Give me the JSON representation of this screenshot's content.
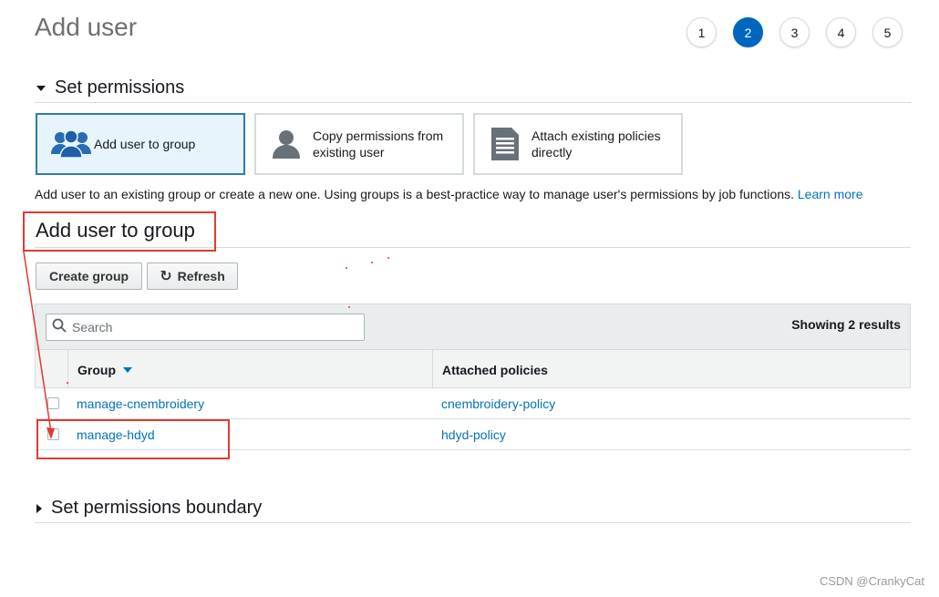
{
  "header": {
    "title": "Add user",
    "steps": [
      "1",
      "2",
      "3",
      "4",
      "5"
    ],
    "active_step": "2"
  },
  "permissions": {
    "section_title": "Set permissions",
    "options": [
      {
        "label": "Add user to group",
        "icon": "group-icon",
        "selected": true
      },
      {
        "label_line1": "Copy permissions from",
        "label_line2": "existing user",
        "icon": "user-icon",
        "selected": false
      },
      {
        "label_line1": "Attach existing policies",
        "label_line2": "directly",
        "icon": "document-icon",
        "selected": false
      }
    ],
    "description": "Add user to an existing group or create a new one. Using groups is a best-practice way to manage user's permissions by job functions.",
    "learn_more": "Learn more"
  },
  "group_section": {
    "title": "Add user to group",
    "create_group_label": "Create group",
    "refresh_label": "Refresh",
    "search_placeholder": "Search",
    "results_text": "Showing 2 results",
    "columns": [
      "Group",
      "Attached policies"
    ],
    "rows": [
      {
        "group": "manage-cnembroidery",
        "policy": "cnembroidery-policy",
        "checked": false
      },
      {
        "group": "manage-hdyd",
        "policy": "hdyd-policy",
        "checked": true
      }
    ]
  },
  "boundary": {
    "section_title": "Set permissions boundary"
  },
  "watermark": "CSDN @CrankyCat",
  "colors": {
    "accent": "#0066bd",
    "link": "#0073bb",
    "annotation": "#e03a32",
    "selected_card_bg": "#e7f4fc"
  }
}
